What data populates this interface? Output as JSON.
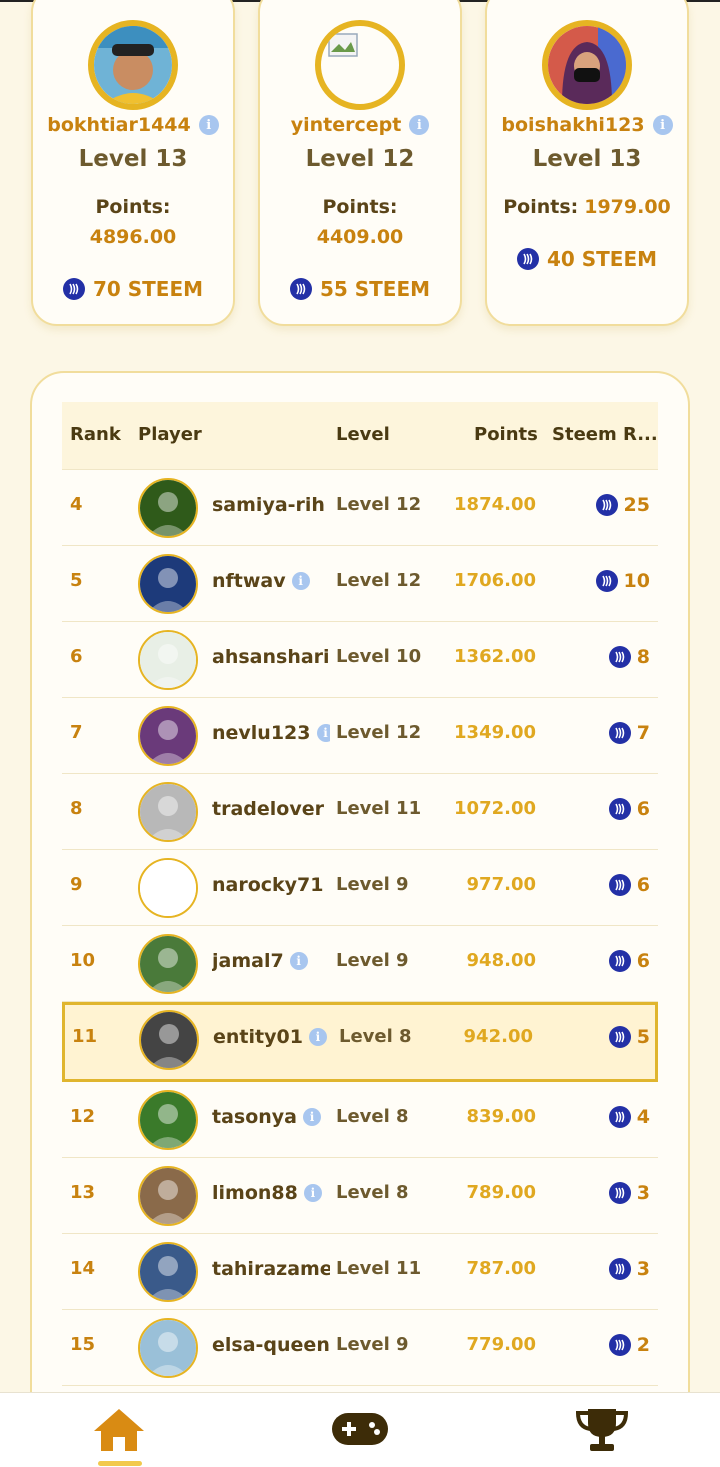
{
  "podium": [
    {
      "username": "bokhtiar1444",
      "level": "Level 13",
      "points_label": "Points:",
      "points": "4896.00",
      "reward": "70 STEEM",
      "avatar": "user-photo"
    },
    {
      "username": "yintercept",
      "level": "Level 12",
      "points_label": "Points:",
      "points": "4409.00",
      "reward": "55 STEEM",
      "avatar": "broken-image"
    },
    {
      "username": "boishakhi123",
      "level": "Level 13",
      "points_label": "Points:",
      "points": "1979.00",
      "reward": "40 STEEM",
      "avatar": "user-photo"
    }
  ],
  "table": {
    "headers": {
      "rank": "Rank",
      "player": "Player",
      "level": "Level",
      "points": "Points",
      "reward": "Steem R..."
    },
    "rows": [
      {
        "rank": "4",
        "player": "samiya-rih",
        "level": "Level 12",
        "points": "1874.00",
        "reward": "25",
        "info": false
      },
      {
        "rank": "5",
        "player": "nftwav",
        "level": "Level 12",
        "points": "1706.00",
        "reward": "10",
        "info": true
      },
      {
        "rank": "6",
        "player": "ahsanshari",
        "level": "Level 10",
        "points": "1362.00",
        "reward": "8",
        "info": false
      },
      {
        "rank": "7",
        "player": "nevlu123",
        "level": "Level 12",
        "points": "1349.00",
        "reward": "7",
        "info": true
      },
      {
        "rank": "8",
        "player": "tradelover",
        "level": "Level 11",
        "points": "1072.00",
        "reward": "6",
        "info": false
      },
      {
        "rank": "9",
        "player": "narocky71",
        "level": "Level 9",
        "points": "977.00",
        "reward": "6",
        "info": true
      },
      {
        "rank": "10",
        "player": "jamal7",
        "level": "Level 9",
        "points": "948.00",
        "reward": "6",
        "info": true
      },
      {
        "rank": "11",
        "player": "entity01",
        "level": "Level 8",
        "points": "942.00",
        "reward": "5",
        "info": true,
        "highlight": true
      },
      {
        "rank": "12",
        "player": "tasonya",
        "level": "Level 8",
        "points": "839.00",
        "reward": "4",
        "info": true
      },
      {
        "rank": "13",
        "player": "limon88",
        "level": "Level 8",
        "points": "789.00",
        "reward": "3",
        "info": true
      },
      {
        "rank": "14",
        "player": "tahirazame",
        "level": "Level 11",
        "points": "787.00",
        "reward": "3",
        "info": false
      },
      {
        "rank": "15",
        "player": "elsa-queen",
        "level": "Level 9",
        "points": "779.00",
        "reward": "2",
        "info": false
      }
    ]
  },
  "nav": {
    "items": [
      {
        "name": "home",
        "icon": "home-icon",
        "active": true
      },
      {
        "name": "games",
        "icon": "gamepad-icon",
        "active": false
      },
      {
        "name": "leaderboard",
        "icon": "trophy-icon",
        "active": false
      }
    ]
  },
  "colors": {
    "accent": "#c8820f",
    "gold": "#e6b422",
    "steem": "#2330a6",
    "background": "#fcf7e6"
  }
}
